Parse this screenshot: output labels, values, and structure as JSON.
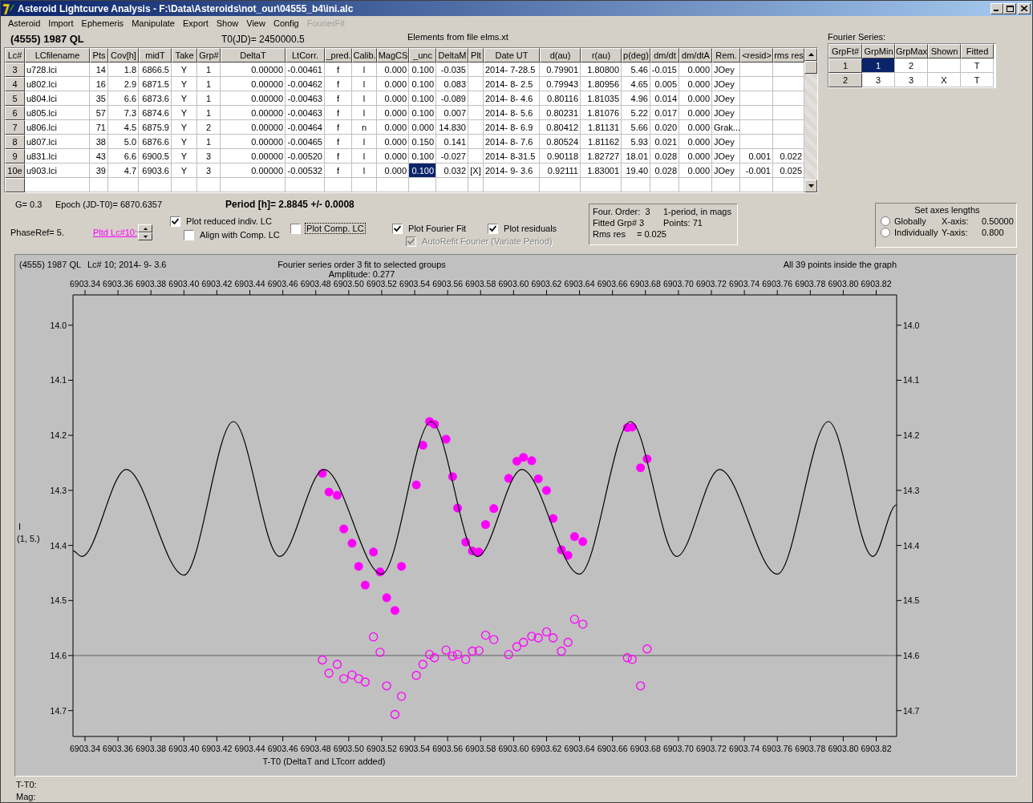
{
  "window": {
    "title": "Asteroid Lightcurve Analysis - F:\\Data\\Asteroids\\not_our\\04555_b4\\ini.alc"
  },
  "menu": [
    {
      "label": "Asteroid",
      "disabled": false
    },
    {
      "label": "Import",
      "disabled": false
    },
    {
      "label": "Ephemeris",
      "disabled": false
    },
    {
      "label": "Manipulate",
      "disabled": false
    },
    {
      "label": "Export",
      "disabled": false
    },
    {
      "label": "Show",
      "disabled": false
    },
    {
      "label": "View",
      "disabled": false
    },
    {
      "label": "Config",
      "disabled": false
    },
    {
      "label": "FourierFit",
      "disabled": true
    }
  ],
  "header": {
    "asteroid": "(4555) 1987 QL",
    "t0": "T0(JD)= 2450000.5",
    "elements": "Elements from file elms.xt"
  },
  "lc_table": {
    "columns": [
      "Lc#",
      "LCfilename",
      "Pts",
      "Cov[h]",
      "midT",
      "Take",
      "Grp#",
      "DeltaT",
      "LtCorr.",
      "_pred.",
      "Calib.",
      "MagCS",
      "_unc",
      "DeltaM",
      "Plt",
      "Date UT",
      "d(au)",
      "r(au)",
      "p(deg)",
      "dm/dt",
      "dm/dtA",
      "Rem.",
      "<resid>",
      "rms res"
    ],
    "rows": [
      {
        "cells": [
          {
            "text": "3",
            "selected": false
          },
          {
            "text": "u728.lci",
            "selected": false
          },
          {
            "text": "14",
            "selected": false
          },
          {
            "text": "1.8",
            "selected": false
          },
          {
            "text": "6866.5",
            "selected": false
          },
          {
            "text": "Y",
            "selected": false
          },
          {
            "text": "1",
            "selected": false
          },
          {
            "text": "0.00000",
            "selected": false
          },
          {
            "text": "-0.00461",
            "selected": false
          },
          {
            "text": "f",
            "selected": false
          },
          {
            "text": "l",
            "selected": false
          },
          {
            "text": "0.000",
            "selected": false
          },
          {
            "text": "0.100",
            "selected": false
          },
          {
            "text": "-0.035",
            "selected": false
          },
          {
            "text": "",
            "selected": false
          },
          {
            "text": "2014- 7-28.5",
            "selected": false
          },
          {
            "text": "0.79901",
            "selected": false
          },
          {
            "text": "1.80800",
            "selected": false
          },
          {
            "text": "5.46",
            "selected": false
          },
          {
            "text": "-0.015",
            "selected": false
          },
          {
            "text": "0.000",
            "selected": false
          },
          {
            "text": "JOey",
            "selected": false
          },
          {
            "text": "",
            "selected": false
          },
          {
            "text": "",
            "selected": false
          }
        ]
      },
      {
        "cells": [
          {
            "text": "4",
            "selected": false
          },
          {
            "text": "u802.lci",
            "selected": false
          },
          {
            "text": "16",
            "selected": false
          },
          {
            "text": "2.9",
            "selected": false
          },
          {
            "text": "6871.5",
            "selected": false
          },
          {
            "text": "Y",
            "selected": false
          },
          {
            "text": "1",
            "selected": false
          },
          {
            "text": "0.00000",
            "selected": false
          },
          {
            "text": "-0.00462",
            "selected": false
          },
          {
            "text": "f",
            "selected": false
          },
          {
            "text": "l",
            "selected": false
          },
          {
            "text": "0.000",
            "selected": false
          },
          {
            "text": "0.100",
            "selected": false
          },
          {
            "text": "0.083",
            "selected": false
          },
          {
            "text": "",
            "selected": false
          },
          {
            "text": "2014- 8- 2.5",
            "selected": false
          },
          {
            "text": "0.79943",
            "selected": false
          },
          {
            "text": "1.80956",
            "selected": false
          },
          {
            "text": "4.65",
            "selected": false
          },
          {
            "text": "0.005",
            "selected": false
          },
          {
            "text": "0.000",
            "selected": false
          },
          {
            "text": "JOey",
            "selected": false
          },
          {
            "text": "",
            "selected": false
          },
          {
            "text": "",
            "selected": false
          }
        ]
      },
      {
        "cells": [
          {
            "text": "5",
            "selected": false
          },
          {
            "text": "u804.lci",
            "selected": false
          },
          {
            "text": "35",
            "selected": false
          },
          {
            "text": "6.6",
            "selected": false
          },
          {
            "text": "6873.6",
            "selected": false
          },
          {
            "text": "Y",
            "selected": false
          },
          {
            "text": "1",
            "selected": false
          },
          {
            "text": "0.00000",
            "selected": false
          },
          {
            "text": "-0.00463",
            "selected": false
          },
          {
            "text": "f",
            "selected": false
          },
          {
            "text": "l",
            "selected": false
          },
          {
            "text": "0.000",
            "selected": false
          },
          {
            "text": "0.100",
            "selected": false
          },
          {
            "text": "-0.089",
            "selected": false
          },
          {
            "text": "",
            "selected": false
          },
          {
            "text": "2014- 8- 4.6",
            "selected": false
          },
          {
            "text": "0.80116",
            "selected": false
          },
          {
            "text": "1.81035",
            "selected": false
          },
          {
            "text": "4.96",
            "selected": false
          },
          {
            "text": "0.014",
            "selected": false
          },
          {
            "text": "0.000",
            "selected": false
          },
          {
            "text": "JOey",
            "selected": false
          },
          {
            "text": "",
            "selected": false
          },
          {
            "text": "",
            "selected": false
          }
        ]
      },
      {
        "cells": [
          {
            "text": "6",
            "selected": false
          },
          {
            "text": "u805.lci",
            "selected": false
          },
          {
            "text": "57",
            "selected": false
          },
          {
            "text": "7.3",
            "selected": false
          },
          {
            "text": "6874.6",
            "selected": false
          },
          {
            "text": "Y",
            "selected": false
          },
          {
            "text": "1",
            "selected": false
          },
          {
            "text": "0.00000",
            "selected": false
          },
          {
            "text": "-0.00463",
            "selected": false
          },
          {
            "text": "f",
            "selected": false
          },
          {
            "text": "l",
            "selected": false
          },
          {
            "text": "0.000",
            "selected": false
          },
          {
            "text": "0.100",
            "selected": false
          },
          {
            "text": "0.007",
            "selected": false
          },
          {
            "text": "",
            "selected": false
          },
          {
            "text": "2014- 8- 5.6",
            "selected": false
          },
          {
            "text": "0.80231",
            "selected": false
          },
          {
            "text": "1.81076",
            "selected": false
          },
          {
            "text": "5.22",
            "selected": false
          },
          {
            "text": "0.017",
            "selected": false
          },
          {
            "text": "0.000",
            "selected": false
          },
          {
            "text": "JOey",
            "selected": false
          },
          {
            "text": "",
            "selected": false
          },
          {
            "text": "",
            "selected": false
          }
        ]
      },
      {
        "cells": [
          {
            "text": "7",
            "selected": false
          },
          {
            "text": "u806.lci",
            "selected": false
          },
          {
            "text": "71",
            "selected": false
          },
          {
            "text": "4.5",
            "selected": false
          },
          {
            "text": "6875.9",
            "selected": false
          },
          {
            "text": "Y",
            "selected": false
          },
          {
            "text": "2",
            "selected": false
          },
          {
            "text": "0.00000",
            "selected": false
          },
          {
            "text": "-0.00464",
            "selected": false
          },
          {
            "text": "f",
            "selected": false
          },
          {
            "text": "n",
            "selected": false
          },
          {
            "text": "0.000",
            "selected": false
          },
          {
            "text": "0.000",
            "selected": false
          },
          {
            "text": "14.830",
            "selected": false
          },
          {
            "text": "",
            "selected": false
          },
          {
            "text": "2014- 8- 6.9",
            "selected": false
          },
          {
            "text": "0.80412",
            "selected": false
          },
          {
            "text": "1.81131",
            "selected": false
          },
          {
            "text": "5.66",
            "selected": false
          },
          {
            "text": "0.020",
            "selected": false
          },
          {
            "text": "0.000",
            "selected": false
          },
          {
            "text": "Grak...",
            "selected": false
          },
          {
            "text": "",
            "selected": false
          },
          {
            "text": "",
            "selected": false
          }
        ]
      },
      {
        "cells": [
          {
            "text": "8",
            "selected": false
          },
          {
            "text": "u807.lci",
            "selected": false
          },
          {
            "text": "38",
            "selected": false
          },
          {
            "text": "5.0",
            "selected": false
          },
          {
            "text": "6876.6",
            "selected": false
          },
          {
            "text": "Y",
            "selected": false
          },
          {
            "text": "1",
            "selected": false
          },
          {
            "text": "0.00000",
            "selected": false
          },
          {
            "text": "-0.00465",
            "selected": false
          },
          {
            "text": "f",
            "selected": false
          },
          {
            "text": "l",
            "selected": false
          },
          {
            "text": "0.000",
            "selected": false
          },
          {
            "text": "0.150",
            "selected": false
          },
          {
            "text": "0.141",
            "selected": false
          },
          {
            "text": "",
            "selected": false
          },
          {
            "text": "2014- 8- 7.6",
            "selected": false
          },
          {
            "text": "0.80524",
            "selected": false
          },
          {
            "text": "1.81162",
            "selected": false
          },
          {
            "text": "5.93",
            "selected": false
          },
          {
            "text": "0.021",
            "selected": false
          },
          {
            "text": "0.000",
            "selected": false
          },
          {
            "text": "JOey",
            "selected": false
          },
          {
            "text": "",
            "selected": false
          },
          {
            "text": "",
            "selected": false
          }
        ]
      },
      {
        "cells": [
          {
            "text": "9",
            "selected": false
          },
          {
            "text": "u831.lci",
            "selected": false
          },
          {
            "text": "43",
            "selected": false
          },
          {
            "text": "6.6",
            "selected": false
          },
          {
            "text": "6900.5",
            "selected": false
          },
          {
            "text": "Y",
            "selected": false
          },
          {
            "text": "3",
            "selected": false
          },
          {
            "text": "0.00000",
            "selected": false
          },
          {
            "text": "-0.00520",
            "selected": false
          },
          {
            "text": "f",
            "selected": false
          },
          {
            "text": "l",
            "selected": false
          },
          {
            "text": "0.000",
            "selected": false
          },
          {
            "text": "0.100",
            "selected": false
          },
          {
            "text": "-0.027",
            "selected": false
          },
          {
            "text": "",
            "selected": false
          },
          {
            "text": "2014- 8-31.5",
            "selected": false
          },
          {
            "text": "0.90118",
            "selected": false
          },
          {
            "text": "1.82727",
            "selected": false
          },
          {
            "text": "18.01",
            "selected": false
          },
          {
            "text": "0.028",
            "selected": false
          },
          {
            "text": "0.000",
            "selected": false
          },
          {
            "text": "JOey",
            "selected": false
          },
          {
            "text": "0.001",
            "selected": false
          },
          {
            "text": "0.022",
            "selected": false
          }
        ]
      },
      {
        "cells": [
          {
            "text": "10e",
            "selected": false
          },
          {
            "text": "u903.lci",
            "selected": false
          },
          {
            "text": "39",
            "selected": false
          },
          {
            "text": "4.7",
            "selected": false
          },
          {
            "text": "6903.6",
            "selected": false
          },
          {
            "text": "Y",
            "selected": false
          },
          {
            "text": "3",
            "selected": false
          },
          {
            "text": "0.00000",
            "selected": false
          },
          {
            "text": "-0.00532",
            "selected": false
          },
          {
            "text": "f",
            "selected": false
          },
          {
            "text": "l",
            "selected": false
          },
          {
            "text": "0.000",
            "selected": false
          },
          {
            "text": "0.100",
            "selected": true
          },
          {
            "text": "0.032",
            "selected": false
          },
          {
            "text": "[X]",
            "selected": false
          },
          {
            "text": "2014- 9- 3.6",
            "selected": false
          },
          {
            "text": "0.92111",
            "selected": false
          },
          {
            "text": "1.83001",
            "selected": false
          },
          {
            "text": "19.40",
            "selected": false
          },
          {
            "text": "0.028",
            "selected": false
          },
          {
            "text": "0.000",
            "selected": false
          },
          {
            "text": "JOey",
            "selected": false
          },
          {
            "text": "-0.001",
            "selected": false
          },
          {
            "text": "0.025",
            "selected": false
          }
        ]
      }
    ]
  },
  "fourier_table": {
    "title": "Fourier Series:",
    "columns": [
      "GrpFt#",
      "GrpMin",
      "GrpMax",
      "Shown",
      "Fitted"
    ],
    "rows": [
      {
        "cells": [
          {
            "text": "1",
            "selected": false
          },
          {
            "text": "1",
            "selected": true
          },
          {
            "text": "2",
            "selected": false
          },
          {
            "text": "",
            "selected": false
          },
          {
            "text": "T",
            "selected": false
          }
        ]
      },
      {
        "cells": [
          {
            "text": "2",
            "selected": false
          },
          {
            "text": "3",
            "selected": false
          },
          {
            "text": "3",
            "selected": false
          },
          {
            "text": "X",
            "selected": false
          },
          {
            "text": "T",
            "selected": false
          }
        ]
      }
    ]
  },
  "fit_info": {
    "g": "G= 0.3",
    "epoch": "Epoch (JD-T0)= 6870.6357",
    "period": "Period [h]= 2.8845 +/- 0.0008",
    "phase_ref": "PhaseRef= 5.",
    "plotted_lc_link": "Pltd Lc#10:"
  },
  "plot_options": [
    [
      {
        "label": "Plot reduced indiv. LC",
        "checked": true,
        "disabled": false,
        "focused": false
      },
      {
        "label": "Align with Comp. LC",
        "checked": false,
        "disabled": false,
        "focused": false
      }
    ],
    [
      {
        "label": "Plot Comp. LC",
        "checked": false,
        "disabled": false,
        "focused": true
      }
    ],
    [
      {
        "label": "Plot Fourier Fit",
        "checked": true,
        "disabled": false,
        "focused": false
      },
      {
        "label": "AutoRefit Fourier (Variate Period)",
        "checked": true,
        "disabled": true,
        "focused": false
      }
    ],
    [
      {
        "label": "Plot residuals",
        "checked": true,
        "disabled": false,
        "focused": false
      }
    ]
  ],
  "fourier_summary": {
    "order": "Four. Order:  3",
    "mode": "1-period, in mags",
    "fitted_group": "Fitted Grp# 3",
    "points": "Points: 71",
    "rms_label": "Rms res",
    "rms_value": "= 0.025"
  },
  "axes_lengths": {
    "title": "Set axes lengths",
    "options": [
      {
        "label": "Globally",
        "selected": false
      },
      {
        "label": "Individually",
        "selected": false
      }
    ],
    "x_label": "X-axis:",
    "x_value": "0.50000",
    "y_label": "Y-axis:",
    "y_value": "0.800"
  },
  "plot": {
    "object": "(4555) 1987 QL",
    "lc_info": "Lc# 10; 2014- 9- 3.6",
    "amplitude": "Amplitude: 0.277",
    "points_note": "All 39 points inside the graph",
    "y_caption": "I",
    "scale_note": "(1, 5.)",
    "chart_data": {
      "type": "scatter",
      "title": "Fourier series order 3 fit to selected groups",
      "xlabel": "T-T0 (DeltaT and LTcorr added)",
      "xlim": [
        6903.3327,
        6903.8324
      ],
      "ylim": [
        14.747,
        13.945
      ],
      "xticks": [
        {
          "value": 6903.34,
          "label": "6903.34"
        },
        {
          "value": 6903.36,
          "label": "6903.36"
        },
        {
          "value": 6903.38,
          "label": "6903.38"
        },
        {
          "value": 6903.4,
          "label": "6903.40"
        },
        {
          "value": 6903.42,
          "label": "6903.42"
        },
        {
          "value": 6903.44,
          "label": "6903.44"
        },
        {
          "value": 6903.46,
          "label": "6903.46"
        },
        {
          "value": 6903.48,
          "label": "6903.48"
        },
        {
          "value": 6903.5,
          "label": "6903.50"
        },
        {
          "value": 6903.52,
          "label": "6903.52"
        },
        {
          "value": 6903.54,
          "label": "6903.54"
        },
        {
          "value": 6903.56,
          "label": "6903.56"
        },
        {
          "value": 6903.58,
          "label": "6903.58"
        },
        {
          "value": 6903.6,
          "label": "6903.60"
        },
        {
          "value": 6903.62,
          "label": "6903.62"
        },
        {
          "value": 6903.64,
          "label": "6903.64"
        },
        {
          "value": 6903.66,
          "label": "6903.66"
        },
        {
          "value": 6903.68,
          "label": "6903.68"
        },
        {
          "value": 6903.7,
          "label": "6903.70"
        },
        {
          "value": 6903.72,
          "label": "6903.72"
        },
        {
          "value": 6903.74,
          "label": "6903.74"
        },
        {
          "value": 6903.76,
          "label": "6903.76"
        },
        {
          "value": 6903.78,
          "label": "6903.78"
        },
        {
          "value": 6903.8,
          "label": "6903.80"
        },
        {
          "value": 6903.82,
          "label": "6903.82"
        }
      ],
      "yticks": [
        {
          "value": 14,
          "label": "14.0"
        },
        {
          "value": 14.1,
          "label": "14.1"
        },
        {
          "value": 14.2,
          "label": "14.2"
        },
        {
          "value": 14.3,
          "label": "14.3"
        },
        {
          "value": 14.4,
          "label": "14.4"
        },
        {
          "value": 14.5,
          "label": "14.5"
        },
        {
          "value": 14.6,
          "label": "14.6"
        },
        {
          "value": 14.7,
          "label": "14.7"
        }
      ],
      "series": [
        {
          "type": "scatter",
          "marker": "circle",
          "color": "#ff00ff",
          "x": [
            6903.484,
            6903.488,
            6903.493,
            6903.497,
            6903.502,
            6903.506,
            6903.51,
            6903.515,
            6903.519,
            6903.523,
            6903.528,
            6903.532,
            6903.541,
            6903.545,
            6903.549,
            6903.552,
            6903.559,
            6903.563,
            6903.566,
            6903.571,
            6903.575,
            6903.579,
            6903.583,
            6903.588,
            6903.597,
            6903.602,
            6903.606,
            6903.611,
            6903.615,
            6903.62,
            6903.624,
            6903.629,
            6903.633,
            6903.637,
            6903.642,
            6903.669,
            6903.672,
            6903.677,
            6903.681
          ],
          "values": [
            14.269,
            14.303,
            14.309,
            14.37,
            14.396,
            14.438,
            14.472,
            14.412,
            14.448,
            14.495,
            14.518,
            14.438,
            14.29,
            14.218,
            14.175,
            14.18,
            14.207,
            14.275,
            14.332,
            14.394,
            14.41,
            14.412,
            14.362,
            14.333,
            14.278,
            14.247,
            14.24,
            14.246,
            14.279,
            14.3,
            14.351,
            14.408,
            14.418,
            14.384,
            14.393,
            14.186,
            14.185,
            14.259,
            14.243
          ]
        },
        {
          "type": "scatter",
          "marker": "circle",
          "color": "#ff00ff",
          "x": [
            6903.484,
            6903.488,
            6903.493,
            6903.497,
            6903.502,
            6903.506,
            6903.51,
            6903.515,
            6903.519,
            6903.523,
            6903.528,
            6903.532,
            6903.541,
            6903.545,
            6903.549,
            6903.552,
            6903.559,
            6903.563,
            6903.566,
            6903.571,
            6903.575,
            6903.579,
            6903.583,
            6903.588,
            6903.597,
            6903.602,
            6903.606,
            6903.611,
            6903.615,
            6903.62,
            6903.624,
            6903.629,
            6903.633,
            6903.637,
            6903.642,
            6903.669,
            6903.672,
            6903.677,
            6903.681
          ],
          "values": [
            14.608,
            14.632,
            14.616,
            14.642,
            14.635,
            14.642,
            14.648,
            14.566,
            14.594,
            14.655,
            14.707,
            14.674,
            14.636,
            14.616,
            14.598,
            14.604,
            14.59,
            14.601,
            14.598,
            14.607,
            14.592,
            14.591,
            14.563,
            14.571,
            14.598,
            14.584,
            14.576,
            14.565,
            14.568,
            14.557,
            14.568,
            14.592,
            14.576,
            14.534,
            14.543,
            14.604,
            14.607,
            14.655,
            14.588
          ]
        },
        {
          "type": "line",
          "color": "#000000",
          "x": [
            6903.3327,
            6903.338,
            6903.365,
            6903.4,
            6903.43,
            6903.458,
            6903.485,
            6903.52,
            6903.55,
            6903.578,
            6903.605,
            6903.64,
            6903.671,
            6903.699,
            6903.725,
            6903.76,
            6903.791,
            6903.818,
            6903.8324
          ],
          "values": [
            14.41,
            14.42,
            14.262,
            14.454,
            14.175,
            14.42,
            14.262,
            14.452,
            14.175,
            14.42,
            14.262,
            14.452,
            14.175,
            14.42,
            14.262,
            14.452,
            14.175,
            14.42,
            14.326
          ]
        }
      ],
      "ref_lines": [
        {
          "axis": "y",
          "value": 14.6
        }
      ]
    }
  },
  "status": {
    "t_label": "T-T0:",
    "mag_label": "Mag:"
  }
}
